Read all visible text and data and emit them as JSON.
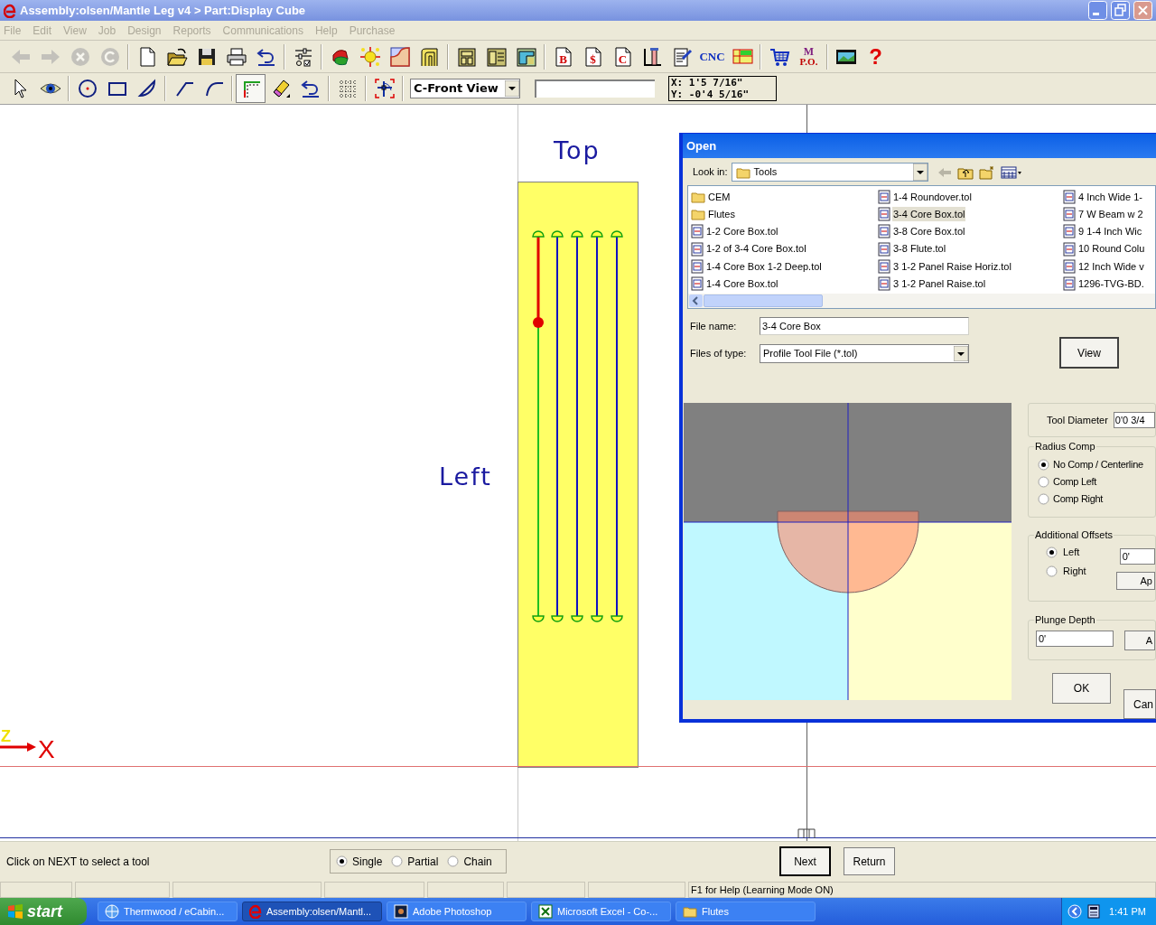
{
  "window": {
    "title": "Assembly:olsen/Mantle Leg v4 > Part:Display Cube"
  },
  "menu": [
    {
      "label": "File",
      "disabled": true
    },
    {
      "label": "Edit",
      "disabled": true
    },
    {
      "label": "View",
      "disabled": true
    },
    {
      "label": "Job",
      "disabled": true
    },
    {
      "label": "Design",
      "disabled": true
    },
    {
      "label": "Reports",
      "disabled": true
    },
    {
      "label": "Communications",
      "disabled": true
    },
    {
      "label": "Help",
      "disabled": true
    },
    {
      "label": "Purchase",
      "disabled": true
    }
  ],
  "toolbar_1": [
    {
      "items": [
        {
          "kind": "back",
          "disabled": true
        },
        {
          "kind": "forward",
          "disabled": true
        },
        {
          "kind": "stop",
          "disabled": true
        },
        {
          "kind": "refresh",
          "disabled": true
        }
      ]
    },
    {
      "items": [
        {
          "kind": "new",
          "disabled": false
        },
        {
          "kind": "open",
          "disabled": false
        },
        {
          "kind": "save",
          "disabled": false
        },
        {
          "kind": "print",
          "disabled": false
        },
        {
          "kind": "undo",
          "disabled": false
        }
      ]
    },
    {
      "items": [
        {
          "kind": "sliders",
          "disabled": false
        }
      ]
    },
    {
      "items": [
        {
          "kind": "paint",
          "disabled": false
        },
        {
          "kind": "sun",
          "disabled": false
        },
        {
          "kind": "profile",
          "disabled": false
        },
        {
          "kind": "door",
          "disabled": false
        }
      ]
    },
    {
      "items": [
        {
          "kind": "cabinet",
          "disabled": false
        },
        {
          "kind": "cabinet2",
          "disabled": false
        },
        {
          "kind": "cabinet3",
          "disabled": false
        }
      ]
    },
    {
      "items": [
        {
          "kind": "report",
          "label": "B",
          "disabled": false
        },
        {
          "kind": "report",
          "label": "$",
          "disabled": false
        },
        {
          "kind": "report",
          "label": "C",
          "disabled": false
        },
        {
          "kind": "ruler",
          "disabled": false
        },
        {
          "kind": "sign",
          "disabled": false
        },
        {
          "kind": "cnc",
          "label": "CNC",
          "disabled": false
        },
        {
          "kind": "layout",
          "disabled": false
        }
      ]
    },
    {
      "items": [
        {
          "kind": "cart",
          "disabled": false
        },
        {
          "kind": "po",
          "label": "M",
          "sublabel": "P.O.",
          "disabled": false
        }
      ]
    },
    {
      "items": [
        {
          "kind": "film",
          "disabled": false
        },
        {
          "kind": "help",
          "label": "?",
          "disabled": false
        }
      ]
    }
  ],
  "toolbar_2": [
    {
      "items": [
        {
          "kind": "pointer",
          "pressed": false
        },
        {
          "kind": "eye",
          "pressed": false
        }
      ]
    },
    {
      "items": [
        {
          "kind": "circle",
          "pressed": false
        },
        {
          "kind": "rect",
          "pressed": false
        },
        {
          "kind": "arc",
          "pressed": false
        }
      ]
    },
    {
      "items": [
        {
          "kind": "line",
          "pressed": false
        },
        {
          "kind": "fillet",
          "pressed": false
        }
      ]
    },
    {
      "items": [
        {
          "kind": "corner",
          "pressed": true
        },
        {
          "kind": "eraser",
          "pressed": false
        },
        {
          "kind": "undo",
          "pressed": false
        }
      ]
    },
    {
      "items": [
        {
          "kind": "dots",
          "pressed": false
        }
      ]
    },
    {
      "items": [
        {
          "kind": "snap",
          "pressed": false
        }
      ]
    }
  ],
  "view_select": {
    "value": "C-Front View"
  },
  "coordinates": {
    "x": "X: 1'5 7/16\"",
    "y": "Y: -0'4 5/16\""
  },
  "canvas": {
    "top_label": "Top",
    "left_label": "Left",
    "axis_z": "Z",
    "axis_x": "X",
    "toolpaths": [
      {
        "selected": true
      },
      {
        "selected": false
      },
      {
        "selected": false
      },
      {
        "selected": false
      },
      {
        "selected": false
      }
    ]
  },
  "dialog": {
    "title": "Open",
    "look_in": {
      "label": "Look in:",
      "value": "Tools"
    },
    "files": [
      {
        "kind": "folder",
        "name": "CEM",
        "selected": false
      },
      {
        "kind": "folder",
        "name": "Flutes",
        "selected": false
      },
      {
        "kind": "file",
        "name": "1-2 Core Box.tol",
        "selected": false
      },
      {
        "kind": "file",
        "name": "1-2 of 3-4 Core Box.tol",
        "selected": false
      },
      {
        "kind": "file",
        "name": "1-4 Core Box 1-2 Deep.tol",
        "selected": false
      },
      {
        "kind": "file",
        "name": "1-4 Core Box.tol",
        "selected": false
      },
      {
        "kind": "file",
        "name": "1-4 Roundover.tol",
        "selected": false
      },
      {
        "kind": "file",
        "name": "3-4 Core Box.tol",
        "selected": true
      },
      {
        "kind": "file",
        "name": "3-8 Core Box.tol",
        "selected": false
      },
      {
        "kind": "file",
        "name": "3-8 Flute.tol",
        "selected": false
      },
      {
        "kind": "file",
        "name": "3 1-2 Panel Raise Horiz.tol",
        "selected": false
      },
      {
        "kind": "file",
        "name": "3 1-2 Panel Raise.tol",
        "selected": false
      },
      {
        "kind": "file",
        "name": "4 Inch Wide 1-",
        "selected": false
      },
      {
        "kind": "file",
        "name": "7 W Beam w 2",
        "selected": false
      },
      {
        "kind": "file",
        "name": "9 1-4 Inch Wic",
        "selected": false
      },
      {
        "kind": "file",
        "name": "10 Round Colu",
        "selected": false
      },
      {
        "kind": "file",
        "name": "12 Inch Wide v",
        "selected": false
      },
      {
        "kind": "file",
        "name": "1296-TVG-BD.",
        "selected": false
      }
    ],
    "file_name": {
      "label": "File name:",
      "value": "3-4 Core Box"
    },
    "file_type": {
      "label": "Files of type:",
      "value": "Profile Tool File (*.tol)"
    },
    "view_button": "View",
    "tool_diameter": {
      "label": "Tool Diameter",
      "value": "0'0 3/4"
    },
    "radius_comp": {
      "title": "Radius Comp",
      "options": [
        {
          "label": "No Comp / Centerline",
          "selected": true
        },
        {
          "label": "Comp Left",
          "selected": false
        },
        {
          "label": "Comp Right",
          "selected": false
        }
      ]
    },
    "additional_offsets": {
      "title": "Additional Offsets",
      "options": [
        {
          "label": "Left",
          "selected": true
        },
        {
          "label": "Right",
          "selected": false
        }
      ],
      "value": "0'",
      "button": "Ap"
    },
    "plunge_depth": {
      "title": "Plunge Depth",
      "value": "0'",
      "button": "A"
    },
    "ok_button": "OK",
    "cancel_button": "Can"
  },
  "prompt": "Click on NEXT to select a tool",
  "selection_mode": [
    {
      "label": "Single",
      "selected": true
    },
    {
      "label": "Partial",
      "selected": false
    },
    {
      "label": "Chain",
      "selected": false
    }
  ],
  "next_button": "Next",
  "return_button": "Return",
  "status_bar": {
    "help": "F1 for Help (Learning Mode ON)"
  },
  "taskbar": {
    "start": "start",
    "tasks": [
      {
        "kind": "browser",
        "label": "Thermwood / eCabin...",
        "selected": false
      },
      {
        "kind": "app",
        "label": "Assembly:olsen/Mantl...",
        "selected": true
      },
      {
        "kind": "photo",
        "label": "Adobe Photoshop",
        "selected": false
      },
      {
        "kind": "sheet",
        "label": "Microsoft Excel - Co-...",
        "selected": false
      },
      {
        "kind": "folder",
        "label": "Flutes",
        "selected": false
      }
    ],
    "clock": "1:41 PM"
  }
}
